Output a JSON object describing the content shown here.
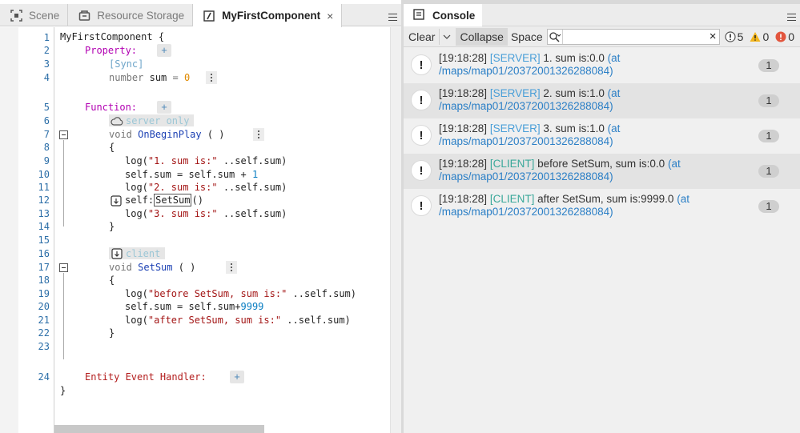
{
  "tabs": [
    {
      "label": "Scene",
      "icon": "scene-icon"
    },
    {
      "label": "Resource Storage",
      "icon": "storage-icon"
    },
    {
      "label": "MyFirstComponent",
      "icon": "script-file-icon",
      "active": true,
      "close": "×"
    }
  ],
  "editor": {
    "line_numbers": [
      "1",
      "2",
      "3",
      "4",
      "5",
      "6",
      "7",
      "8",
      "9",
      "10",
      "11",
      "12",
      "13",
      "14",
      "15",
      "16",
      "17",
      "18",
      "19",
      "20",
      "21",
      "22",
      "23",
      "24"
    ],
    "component_name": "MyFirstComponent",
    "open_brace": "{",
    "close_brace": "}",
    "property_label": "Property:",
    "sync_label": "[Sync]",
    "prop_type": "number",
    "prop_name": "sum",
    "prop_eq": "=",
    "prop_value": "0",
    "function_label": "Function:",
    "server_only_label": "server only",
    "fn1_decl_kw": "void",
    "fn1_name": "OnBeginPlay",
    "fn1_parens": "( )",
    "fn1_l1_a": "log(",
    "fn1_l1_str": "\"1. sum is:\"",
    "fn1_l1_b": " ..self.sum)",
    "fn1_l2_a": "self.sum = self.sum + ",
    "fn1_l2_num": "1",
    "fn1_l3_a": "log(",
    "fn1_l3_str": "\"2. sum is:\"",
    "fn1_l3_b": " ..self.sum)",
    "fn1_l4_a": "self:",
    "fn1_l4_call": "SetSum",
    "fn1_l4_b": "()",
    "fn1_l5_a": "log(",
    "fn1_l5_str": "\"3. sum is:\"",
    "fn1_l5_b": " ..self.sum)",
    "client_label": "client",
    "fn2_decl_kw": "void",
    "fn2_name": "SetSum",
    "fn2_parens": "( )",
    "fn2_l1_a": "log(",
    "fn2_l1_str": "\"before SetSum, sum is:\"",
    "fn2_l1_b": " ..self.sum)",
    "fn2_l2_a": "self.sum = self.sum+",
    "fn2_l2_num": "9999",
    "fn2_l3_a": "log(",
    "fn2_l3_str": "\"after SetSum, sum is:\"",
    "fn2_l3_b": " ..self.sum)",
    "entity_label": "Entity Event Handler:",
    "plus": "+"
  },
  "console": {
    "title": "Console",
    "toolbar": {
      "clear": "Clear",
      "collapse": "Collapse",
      "space": "Space",
      "search_value": "",
      "clear_search": "×",
      "info_count": "5",
      "warn_count": "0",
      "error_count": "0"
    },
    "logs": [
      {
        "time": "[19:18:28]",
        "source": "[SERVER]",
        "message": "1. sum is:0.0",
        "location": "(at /maps/map01/20372001326288084)",
        "count": "1"
      },
      {
        "time": "[19:18:28]",
        "source": "[SERVER]",
        "message": "2. sum is:1.0",
        "location": "(at /maps/map01/20372001326288084)",
        "count": "1"
      },
      {
        "time": "[19:18:28]",
        "source": "[SERVER]",
        "message": "3. sum is:1.0",
        "location": "(at /maps/map01/20372001326288084)",
        "count": "1"
      },
      {
        "time": "[19:18:28]",
        "source": "[CLIENT]",
        "message": "before SetSum, sum is:0.0",
        "location": "(at /maps/map01/20372001326288084)",
        "count": "1"
      },
      {
        "time": "[19:18:28]",
        "source": "[CLIENT]",
        "message": "after SetSum, sum is:9999.0",
        "location": "(at /maps/map01/20372001326288084)",
        "count": "1"
      }
    ]
  },
  "colors": {
    "server_tag": "#4a9fd8",
    "client_tag": "#3aa89a",
    "property_keyword": "#b200b2",
    "entity_keyword": "#b31d1d",
    "string": "#a31515",
    "number": "#0b7ec2"
  }
}
